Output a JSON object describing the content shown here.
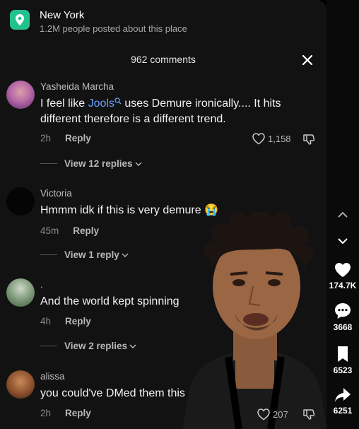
{
  "location": {
    "title": "New York",
    "subtitle": "1.2M people posted about this place",
    "icon": "location-pin-icon",
    "color": "#22c28f"
  },
  "comments_header": {
    "count_label": "962 comments",
    "close_icon": "close-icon"
  },
  "comments": [
    {
      "author": "Yasheida Marcha",
      "text_before": "I feel like ",
      "mention": "Jools",
      "text_after": " uses Demure ironically.... It hits different therefore is a different trend.",
      "time": "2h",
      "reply": "Reply",
      "likes": "1,158",
      "view_replies": "View 12 replies"
    },
    {
      "author": "Victoria",
      "text": "Hmmm idk if this is very demure 😭",
      "time": "45m",
      "reply": "Reply",
      "view_replies": "View 1 reply"
    },
    {
      "author": ".",
      "text": "And the world kept spinning",
      "time": "4h",
      "reply": "Reply",
      "view_replies": "View 2 replies"
    },
    {
      "author": "alissa",
      "text": "you could've DMed them this",
      "time": "2h",
      "reply": "Reply",
      "likes": "207"
    }
  ],
  "sidebar": {
    "likes": "174.7K",
    "comments": "3668",
    "saves": "6523",
    "shares": "6251"
  },
  "colors": {
    "panel": "#121212",
    "mention": "#6aa0ff"
  }
}
